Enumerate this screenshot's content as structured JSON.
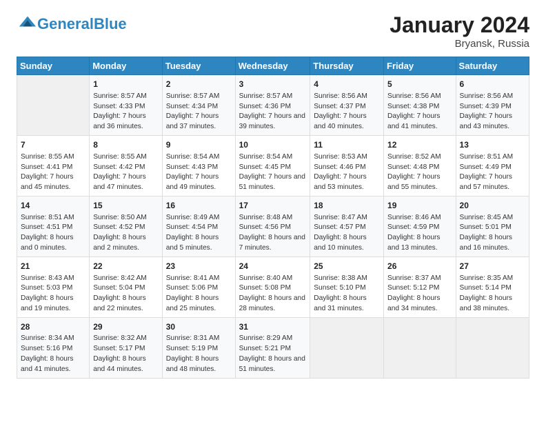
{
  "header": {
    "logo_general": "General",
    "logo_blue": "Blue",
    "month_title": "January 2024",
    "location": "Bryansk, Russia"
  },
  "days_of_week": [
    "Sunday",
    "Monday",
    "Tuesday",
    "Wednesday",
    "Thursday",
    "Friday",
    "Saturday"
  ],
  "weeks": [
    [
      {
        "day": "",
        "sunrise": "",
        "sunset": "",
        "daylight": ""
      },
      {
        "day": "1",
        "sunrise": "Sunrise: 8:57 AM",
        "sunset": "Sunset: 4:33 PM",
        "daylight": "Daylight: 7 hours and 36 minutes."
      },
      {
        "day": "2",
        "sunrise": "Sunrise: 8:57 AM",
        "sunset": "Sunset: 4:34 PM",
        "daylight": "Daylight: 7 hours and 37 minutes."
      },
      {
        "day": "3",
        "sunrise": "Sunrise: 8:57 AM",
        "sunset": "Sunset: 4:36 PM",
        "daylight": "Daylight: 7 hours and 39 minutes."
      },
      {
        "day": "4",
        "sunrise": "Sunrise: 8:56 AM",
        "sunset": "Sunset: 4:37 PM",
        "daylight": "Daylight: 7 hours and 40 minutes."
      },
      {
        "day": "5",
        "sunrise": "Sunrise: 8:56 AM",
        "sunset": "Sunset: 4:38 PM",
        "daylight": "Daylight: 7 hours and 41 minutes."
      },
      {
        "day": "6",
        "sunrise": "Sunrise: 8:56 AM",
        "sunset": "Sunset: 4:39 PM",
        "daylight": "Daylight: 7 hours and 43 minutes."
      }
    ],
    [
      {
        "day": "7",
        "sunrise": "Sunrise: 8:55 AM",
        "sunset": "Sunset: 4:41 PM",
        "daylight": "Daylight: 7 hours and 45 minutes."
      },
      {
        "day": "8",
        "sunrise": "Sunrise: 8:55 AM",
        "sunset": "Sunset: 4:42 PM",
        "daylight": "Daylight: 7 hours and 47 minutes."
      },
      {
        "day": "9",
        "sunrise": "Sunrise: 8:54 AM",
        "sunset": "Sunset: 4:43 PM",
        "daylight": "Daylight: 7 hours and 49 minutes."
      },
      {
        "day": "10",
        "sunrise": "Sunrise: 8:54 AM",
        "sunset": "Sunset: 4:45 PM",
        "daylight": "Daylight: 7 hours and 51 minutes."
      },
      {
        "day": "11",
        "sunrise": "Sunrise: 8:53 AM",
        "sunset": "Sunset: 4:46 PM",
        "daylight": "Daylight: 7 hours and 53 minutes."
      },
      {
        "day": "12",
        "sunrise": "Sunrise: 8:52 AM",
        "sunset": "Sunset: 4:48 PM",
        "daylight": "Daylight: 7 hours and 55 minutes."
      },
      {
        "day": "13",
        "sunrise": "Sunrise: 8:51 AM",
        "sunset": "Sunset: 4:49 PM",
        "daylight": "Daylight: 7 hours and 57 minutes."
      }
    ],
    [
      {
        "day": "14",
        "sunrise": "Sunrise: 8:51 AM",
        "sunset": "Sunset: 4:51 PM",
        "daylight": "Daylight: 8 hours and 0 minutes."
      },
      {
        "day": "15",
        "sunrise": "Sunrise: 8:50 AM",
        "sunset": "Sunset: 4:52 PM",
        "daylight": "Daylight: 8 hours and 2 minutes."
      },
      {
        "day": "16",
        "sunrise": "Sunrise: 8:49 AM",
        "sunset": "Sunset: 4:54 PM",
        "daylight": "Daylight: 8 hours and 5 minutes."
      },
      {
        "day": "17",
        "sunrise": "Sunrise: 8:48 AM",
        "sunset": "Sunset: 4:56 PM",
        "daylight": "Daylight: 8 hours and 7 minutes."
      },
      {
        "day": "18",
        "sunrise": "Sunrise: 8:47 AM",
        "sunset": "Sunset: 4:57 PM",
        "daylight": "Daylight: 8 hours and 10 minutes."
      },
      {
        "day": "19",
        "sunrise": "Sunrise: 8:46 AM",
        "sunset": "Sunset: 4:59 PM",
        "daylight": "Daylight: 8 hours and 13 minutes."
      },
      {
        "day": "20",
        "sunrise": "Sunrise: 8:45 AM",
        "sunset": "Sunset: 5:01 PM",
        "daylight": "Daylight: 8 hours and 16 minutes."
      }
    ],
    [
      {
        "day": "21",
        "sunrise": "Sunrise: 8:43 AM",
        "sunset": "Sunset: 5:03 PM",
        "daylight": "Daylight: 8 hours and 19 minutes."
      },
      {
        "day": "22",
        "sunrise": "Sunrise: 8:42 AM",
        "sunset": "Sunset: 5:04 PM",
        "daylight": "Daylight: 8 hours and 22 minutes."
      },
      {
        "day": "23",
        "sunrise": "Sunrise: 8:41 AM",
        "sunset": "Sunset: 5:06 PM",
        "daylight": "Daylight: 8 hours and 25 minutes."
      },
      {
        "day": "24",
        "sunrise": "Sunrise: 8:40 AM",
        "sunset": "Sunset: 5:08 PM",
        "daylight": "Daylight: 8 hours and 28 minutes."
      },
      {
        "day": "25",
        "sunrise": "Sunrise: 8:38 AM",
        "sunset": "Sunset: 5:10 PM",
        "daylight": "Daylight: 8 hours and 31 minutes."
      },
      {
        "day": "26",
        "sunrise": "Sunrise: 8:37 AM",
        "sunset": "Sunset: 5:12 PM",
        "daylight": "Daylight: 8 hours and 34 minutes."
      },
      {
        "day": "27",
        "sunrise": "Sunrise: 8:35 AM",
        "sunset": "Sunset: 5:14 PM",
        "daylight": "Daylight: 8 hours and 38 minutes."
      }
    ],
    [
      {
        "day": "28",
        "sunrise": "Sunrise: 8:34 AM",
        "sunset": "Sunset: 5:16 PM",
        "daylight": "Daylight: 8 hours and 41 minutes."
      },
      {
        "day": "29",
        "sunrise": "Sunrise: 8:32 AM",
        "sunset": "Sunset: 5:17 PM",
        "daylight": "Daylight: 8 hours and 44 minutes."
      },
      {
        "day": "30",
        "sunrise": "Sunrise: 8:31 AM",
        "sunset": "Sunset: 5:19 PM",
        "daylight": "Daylight: 8 hours and 48 minutes."
      },
      {
        "day": "31",
        "sunrise": "Sunrise: 8:29 AM",
        "sunset": "Sunset: 5:21 PM",
        "daylight": "Daylight: 8 hours and 51 minutes."
      },
      {
        "day": "",
        "sunrise": "",
        "sunset": "",
        "daylight": ""
      },
      {
        "day": "",
        "sunrise": "",
        "sunset": "",
        "daylight": ""
      },
      {
        "day": "",
        "sunrise": "",
        "sunset": "",
        "daylight": ""
      }
    ]
  ]
}
